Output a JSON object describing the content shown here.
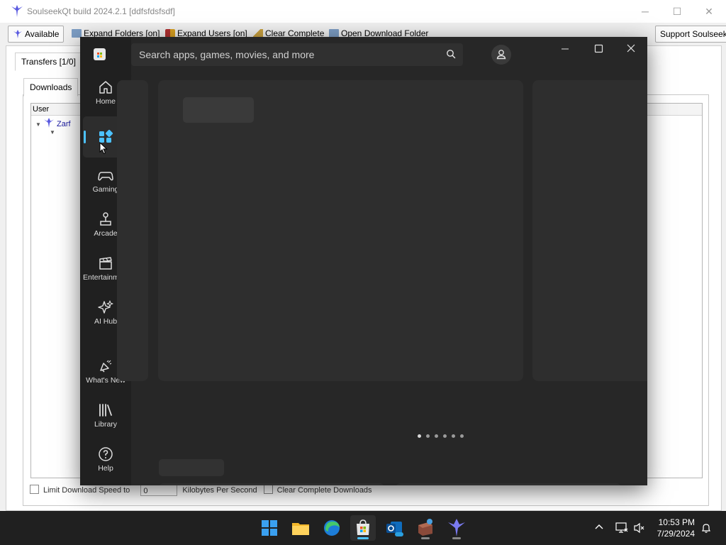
{
  "soulseek": {
    "title": "SoulseekQt build 2024.2.1 [ddfsfdsfsdf]",
    "toolbar": {
      "available": "Available",
      "expand_folders": "Expand Folders [on]",
      "expand_users": "Expand Users [on]",
      "clear_complete": "Clear Complete",
      "open_download_folder": "Open Download Folder",
      "support": "Support Soulseek!"
    },
    "tabs": {
      "transfers": "Transfers [1/0]",
      "downloads": "Downloads"
    },
    "tree": {
      "column_user": "User",
      "row_user": "Zarf"
    },
    "bottom": {
      "limit_label": "Limit Download Speed to",
      "limit_value": "0",
      "unit": "Kilobytes Per Second",
      "clear_complete_downloads": "Clear Complete Downloads"
    }
  },
  "store": {
    "search_placeholder": "Search apps, games, movies, and more",
    "nav": [
      {
        "label": "Home",
        "icon": "home-icon"
      },
      {
        "label": "",
        "icon": "apps-icon",
        "active": true
      },
      {
        "label": "Gaming",
        "icon": "gamepad-icon"
      },
      {
        "label": "Arcade",
        "icon": "joystick-icon"
      },
      {
        "label": "Entertainment",
        "icon": "clapper-icon"
      },
      {
        "label": "AI Hub",
        "icon": "sparkle-icon"
      },
      {
        "label": "What's New",
        "icon": "megaphone-icon"
      },
      {
        "label": "Library",
        "icon": "library-icon"
      },
      {
        "label": "Help",
        "icon": "help-icon"
      }
    ],
    "carousel_pages": 6,
    "carousel_active_index": 0
  },
  "taskbar": {
    "time": "10:53 PM",
    "date": "7/29/2024",
    "apps": [
      "start-icon",
      "file-explorer-icon",
      "edge-icon",
      "store-icon",
      "outlook-icon",
      "app-icon",
      "soulseek-icon"
    ]
  },
  "colors": {
    "accent": "#4cc2ff",
    "store_bg": "#272727",
    "nav_bg": "#202020"
  }
}
